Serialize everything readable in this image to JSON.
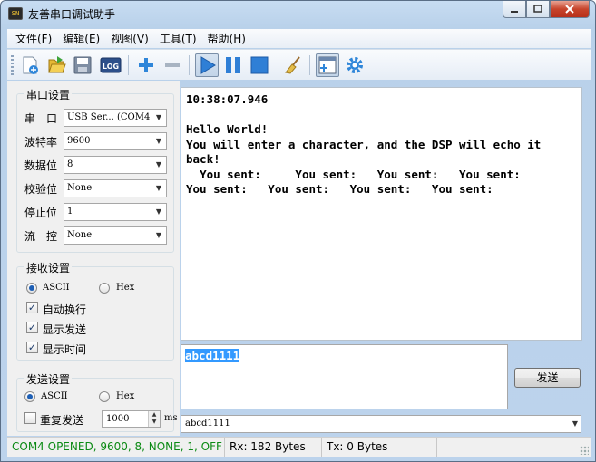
{
  "window": {
    "title": "友善串口调试助手",
    "icon_text": "SN"
  },
  "menu": [
    {
      "label": "文件(F)"
    },
    {
      "label": "编辑(E)"
    },
    {
      "label": "视图(V)"
    },
    {
      "label": "工具(T)"
    },
    {
      "label": "帮助(H)"
    }
  ],
  "toolbar": {
    "log_label": "LOG",
    "icons": [
      "new-file-icon",
      "open-folder-icon",
      "save-icon",
      "log-icon",
      "add-icon",
      "remove-icon",
      "play-icon",
      "pause-icon",
      "stop-icon",
      "broom-icon",
      "layout-window-icon",
      "gear-icon"
    ]
  },
  "serial": {
    "title": "串口设置",
    "port_label": "串　口",
    "port_value": "USB Ser... (COM4",
    "baud_label": "波特率",
    "baud_value": "9600",
    "databits_label": "数据位",
    "databits_value": "8",
    "parity_label": "校验位",
    "parity_value": "None",
    "stopbits_label": "停止位",
    "stopbits_value": "1",
    "flow_label": "流　控",
    "flow_value": "None"
  },
  "receive_settings": {
    "title": "接收设置",
    "ascii_label": "ASCII",
    "hex_label": "Hex",
    "selected": "ASCII",
    "auto_wrap_label": "自动换行",
    "auto_wrap": true,
    "show_send_label": "显示发送",
    "show_send": true,
    "show_time_label": "显示时间",
    "show_time": true
  },
  "send_settings": {
    "title": "发送设置",
    "ascii_label": "ASCII",
    "hex_label": "Hex",
    "selected": "ASCII",
    "repeat_label": "重复发送",
    "repeat": false,
    "interval_value": "1000",
    "interval_unit": "ms"
  },
  "receive_text": "10:38:07.946\n\nHello World!\nYou will enter a character, and the DSP will echo it\nback!\n  You sent:     You sent:   You sent:   You sent:\nYou sent:   You sent:   You sent:   You sent:",
  "send_text": "abcd1111",
  "send_button_label": "发送",
  "history_value": "abcd1111",
  "status": {
    "port_status": "COM4 OPENED, 9600, 8, NONE, 1, OFF",
    "rx": "Rx: 182 Bytes",
    "tx": "Tx: 0 Bytes"
  },
  "colors": {
    "status_ok": "#0b8a14",
    "selection": "#3399ff",
    "accent_blue": "#1d5fb5"
  }
}
